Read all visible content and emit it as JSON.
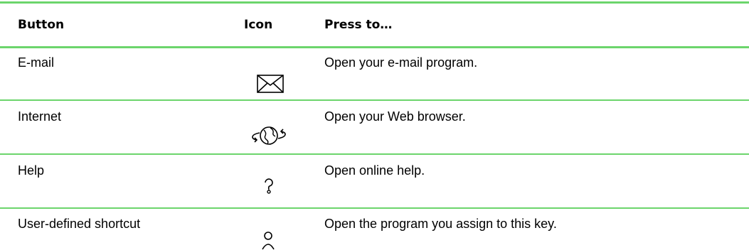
{
  "table": {
    "headers": {
      "button": "Button",
      "icon": "Icon",
      "press_to": "Press to…"
    },
    "rows": [
      {
        "button": "E-mail",
        "icon": "envelope-icon",
        "press_to": "Open your e-mail program."
      },
      {
        "button": "Internet",
        "icon": "globe-arrows-icon",
        "press_to": "Open your Web browser."
      },
      {
        "button": "Help",
        "icon": "question-mark-icon",
        "press_to": "Open online help."
      },
      {
        "button": "User-defined shortcut",
        "icon": "person-icon",
        "press_to": "Open the program you assign to this key."
      }
    ]
  },
  "colors": {
    "rule": "#6cd56c",
    "text": "#000000"
  }
}
